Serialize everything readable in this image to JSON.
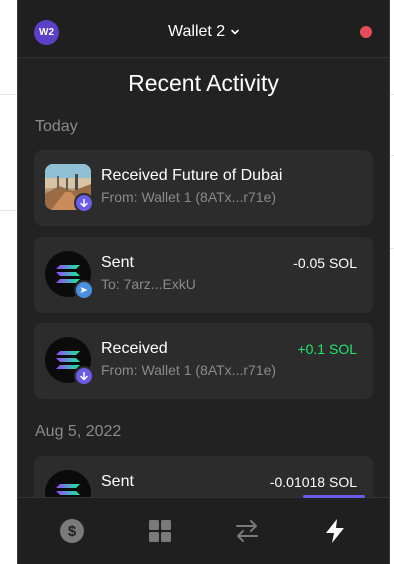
{
  "header": {
    "avatar_initials": "W2",
    "wallet_name": "Wallet 2",
    "status_color": "#e44d58",
    "accent_color": "#6a5ce8"
  },
  "page_title": "Recent Activity",
  "sections": [
    {
      "label": "Today",
      "items": [
        {
          "icon": "nft-image",
          "badge": "receive-arrow-icon",
          "title": "Received Future of Dubai",
          "subtitle": "From: Wallet 1 (8ATx...r71e)",
          "amount": ""
        },
        {
          "icon": "solana-logo",
          "badge": "send-arrow-icon",
          "title": "Sent",
          "subtitle": "To: 7arz...ExkU",
          "amount": "-0.05 SOL"
        },
        {
          "icon": "solana-logo",
          "badge": "receive-arrow-icon",
          "title": "Received",
          "subtitle": "From: Wallet 1 (8ATx...r71e)",
          "amount": "+0.1 SOL"
        }
      ]
    },
    {
      "label": "Aug 5, 2022",
      "items": [
        {
          "icon": "solana-logo",
          "badge": "send-arrow-icon",
          "title": "Sent",
          "subtitle": "",
          "amount": "-0.01018 SOL"
        }
      ]
    }
  ],
  "bottom_nav": [
    {
      "icon": "dollar-icon",
      "active": false
    },
    {
      "icon": "grid-icon",
      "active": false
    },
    {
      "icon": "swap-icon",
      "active": false
    },
    {
      "icon": "lightning-icon",
      "active": true
    }
  ]
}
